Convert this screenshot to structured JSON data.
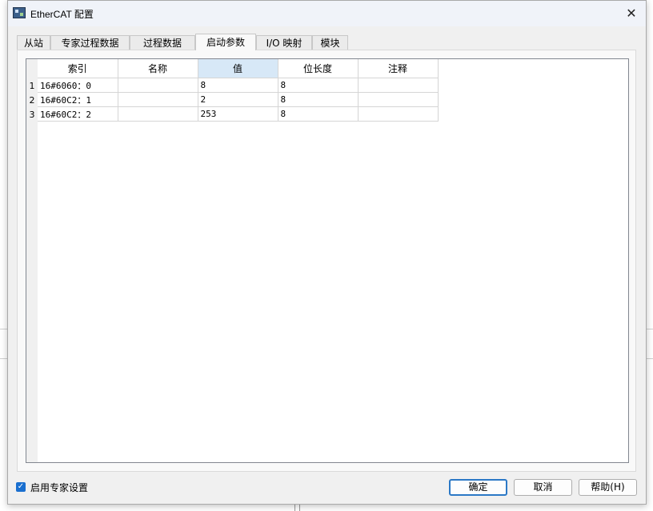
{
  "window": {
    "title": "EtherCAT 配置",
    "close_symbol": "✕"
  },
  "tabs": [
    {
      "label": "从站"
    },
    {
      "label": "专家过程数据"
    },
    {
      "label": "过程数据"
    },
    {
      "label": "启动参数"
    },
    {
      "label": "I/O 映射"
    },
    {
      "label": "模块"
    }
  ],
  "active_tab": "启动参数",
  "table": {
    "columns": [
      "索引",
      "名称",
      "值",
      "位长度",
      "注释"
    ],
    "selected_column": "值",
    "rows": [
      {
        "num": "1",
        "index": "16#6060：0",
        "name": "",
        "value": "8",
        "bitlen": "8",
        "comment": ""
      },
      {
        "num": "2",
        "index": "16#60C2：1",
        "name": "",
        "value": "2",
        "bitlen": "8",
        "comment": ""
      },
      {
        "num": "3",
        "index": "16#60C2：2",
        "name": "",
        "value": "253",
        "bitlen": "8",
        "comment": ""
      }
    ]
  },
  "footer": {
    "expert_checkbox_label": "启用专家设置",
    "expert_checked": true,
    "ok_label": "确定",
    "cancel_label": "取消",
    "help_label": "帮助(H)"
  },
  "icons": {
    "app": "ethercat-app-icon",
    "close": "close-icon",
    "check": "checkmark-icon"
  },
  "colors": {
    "accent": "#1a6fcf",
    "selected_header": "#d7e8f7"
  }
}
